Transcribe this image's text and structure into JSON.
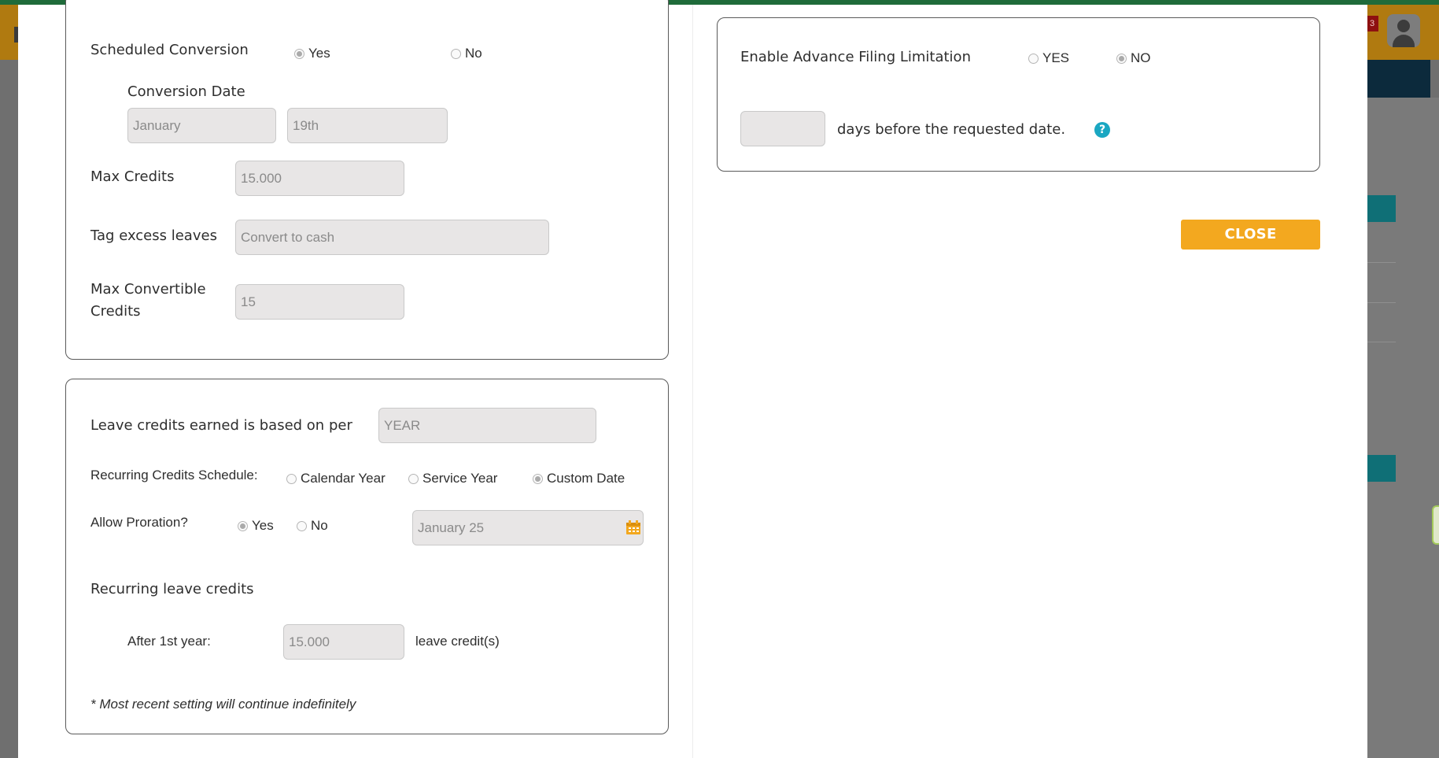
{
  "background": {
    "notification_count": "3"
  },
  "conversion": {
    "scheduled_label": "Scheduled Conversion",
    "yes_label": "Yes",
    "no_label": "No",
    "conversion_date_label": "Conversion Date",
    "month_value": "January",
    "day_value": "19th",
    "max_credits_label": "Max Credits",
    "max_credits_value": "15.000",
    "tag_excess_label": "Tag excess leaves",
    "tag_excess_value": "Convert to cash",
    "max_convertible_label_line1": "Max Convertible",
    "max_convertible_label_line2": "Credits",
    "max_convertible_value": "15"
  },
  "earning": {
    "based_on_label": "Leave credits earned is based on per",
    "based_on_value": "YEAR",
    "schedule_label": "Recurring Credits Schedule:",
    "schedule_options": [
      "Calendar Year",
      "Service Year",
      "Custom Date"
    ],
    "schedule_selected": "Custom Date",
    "proration_label": "Allow Proration?",
    "proration_yes": "Yes",
    "proration_no": "No",
    "custom_date_value": "January 25",
    "recurring_label": "Recurring leave credits",
    "after_year_label": "After 1st year:",
    "after_year_value": "15.000",
    "credits_unit": "leave credit(s)",
    "footnote": "* Most recent setting will continue indefinitely"
  },
  "filing": {
    "enable_label": "Enable Advance Filing Limitation",
    "yes_label": "YES",
    "no_label": "NO",
    "selected": "NO",
    "days_value": "",
    "days_suffix": "days before the requested date."
  },
  "actions": {
    "close_label": "CLOSE"
  },
  "colors": {
    "accent": "#f3a81f",
    "help": "#1aa7c2",
    "field_bg": "#e8e6e6"
  }
}
